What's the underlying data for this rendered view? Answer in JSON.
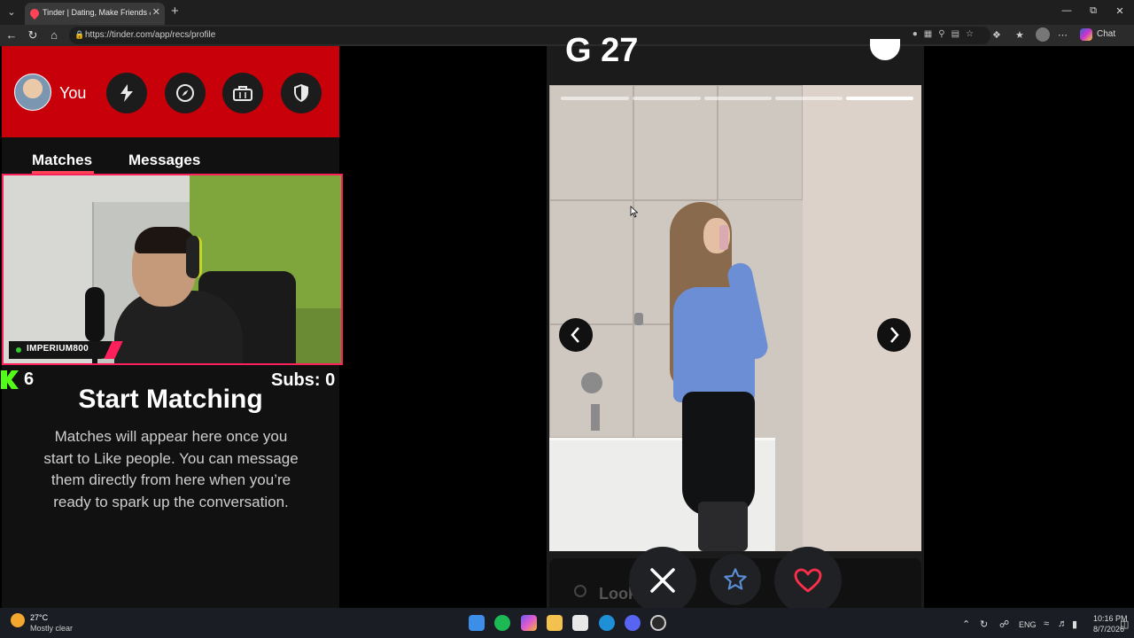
{
  "browser": {
    "tab_title": "Tinder | Dating, Make Friends & M",
    "url": "https://tinder.com/app/recs/profile",
    "copilot_label": "Chat"
  },
  "sidebar": {
    "you_label": "You",
    "tabs": {
      "matches": "Matches",
      "messages": "Messages"
    },
    "header_icons": [
      "bolt-icon",
      "compass-icon",
      "briefcase-icon",
      "shield-icon"
    ],
    "accent_color": "#c8000a",
    "empty_title": "Start Matching",
    "empty_desc": "Matches will appear here once you start to Like people. You can message them directly from here when you’re ready to spark up the conversation."
  },
  "overlay": {
    "streamer_name": "IMPERIUM800",
    "kick_count": "6",
    "subs_text": "Subs: 0"
  },
  "profile": {
    "name_age": "G 27",
    "photo_count": 5,
    "active_photo_index": 4,
    "bottom_text": "Look"
  },
  "actions": [
    "close-icon",
    "star-icon",
    "heart-icon"
  ],
  "taskbar": {
    "temp": "27°C",
    "weather": "Mostly clear",
    "lang": "ENG",
    "time": "10:16 PM",
    "date": "8/7/2026"
  }
}
